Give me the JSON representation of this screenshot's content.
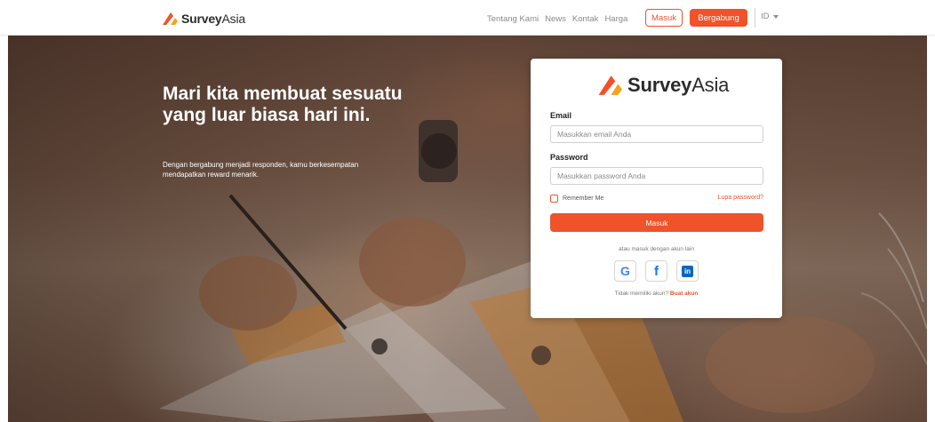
{
  "nav": {
    "brand_bold": "Survey",
    "brand_regular": "Asia",
    "links": [
      "Tentang Kami",
      "News",
      "Kontak",
      "Harga"
    ],
    "login_label": "Masuk",
    "signup_label": "Bergabung",
    "language": "ID"
  },
  "hero": {
    "headline": "Mari kita membuat sesuatu yang luar biasa hari ini.",
    "subtext": "Dengan bergabung menjadi responden, kamu berkesempatan mendapatkan reward menarik."
  },
  "login": {
    "brand_bold": "Survey",
    "brand_regular": "Asia",
    "email_label": "Email",
    "email_placeholder": "Masukkan email Anda",
    "password_label": "Password",
    "password_placeholder": "Masukkan password Anda",
    "remember_label": "Remember Me",
    "forgot_label": "Lupa password?",
    "submit_label": "Masuk",
    "alt_login_text": "atau masuk dengan akun lain",
    "social_buttons": [
      {
        "name": "google",
        "icon": "google-icon",
        "glyph": "G"
      },
      {
        "name": "facebook",
        "icon": "facebook-icon",
        "glyph": "f"
      },
      {
        "name": "linkedin",
        "icon": "linkedin-icon",
        "glyph": "in"
      }
    ],
    "no_account_text": "Tidak memiliki akun?",
    "create_account_label": "Buat akun"
  },
  "colors": {
    "accent": "#f0522a",
    "text_dark": "#222222",
    "muted": "#8a8a8a"
  }
}
